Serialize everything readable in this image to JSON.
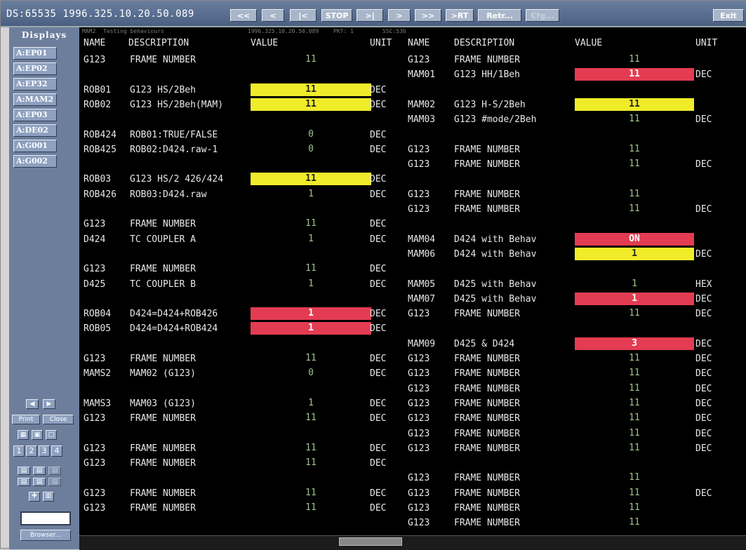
{
  "title": "DS:65535 1996.325.10.20.50.089",
  "nav": [
    "<<",
    "<",
    "|<",
    "STOP",
    ">|",
    ">",
    ">>",
    ">RT",
    "Retr...",
    "Cfg..."
  ],
  "exit_label": "Exit",
  "sidebar": {
    "title": "Displays",
    "items": [
      "A:EP01",
      "A:EP02",
      "A:EP32",
      "A:MAM2",
      "A:EP03",
      "A:DE02",
      "A:G001",
      "A:G002"
    ],
    "print_label": "Print",
    "close_label": "Close",
    "page_numbers": [
      "1",
      "2",
      "3",
      "4"
    ],
    "browser_label": "Browser..."
  },
  "header_strip": {
    "page": "MAM2",
    "subtitle": "Testing behaviours",
    "time": "1996.325.10.20.50.089",
    "pkt": "PKT: 1",
    "ssc": "SSC:536"
  },
  "columns": {
    "name": "NAME",
    "description": "DESCRIPTION",
    "value": "VALUE",
    "unit": "UNIT"
  },
  "left_rows": [
    {
      "r": 0,
      "name": "G123",
      "desc": "FRAME NUMBER",
      "value": "11",
      "hl": "",
      "unit": ""
    },
    {
      "r": 2,
      "name": "ROB01",
      "desc": "G123 HS/2Beh",
      "value": "11",
      "hl": "yellow",
      "unit": "DEC"
    },
    {
      "r": 3,
      "name": "ROB02",
      "desc": "G123 HS/2Beh(MAM)",
      "value": "11",
      "hl": "yellow",
      "unit": "DEC"
    },
    {
      "r": 5,
      "name": "ROB424",
      "desc": "ROB01:TRUE/FALSE",
      "value": "0",
      "hl": "",
      "unit": "DEC"
    },
    {
      "r": 6,
      "name": "ROB425",
      "desc": "ROB02:D424.raw-1",
      "value": "0",
      "hl": "",
      "unit": "DEC"
    },
    {
      "r": 8,
      "name": "ROB03",
      "desc": "G123 HS/2 426/424",
      "value": "11",
      "hl": "yellow",
      "unit": "DEC"
    },
    {
      "r": 9,
      "name": "ROB426",
      "desc": "ROB03:D424.raw",
      "value": "1",
      "hl": "",
      "unit": "DEC"
    },
    {
      "r": 11,
      "name": "G123",
      "desc": "FRAME NUMBER",
      "value": "11",
      "hl": "",
      "unit": "DEC"
    },
    {
      "r": 12,
      "name": "D424",
      "desc": "TC COUPLER A",
      "value": "1",
      "hl": "",
      "unit": "DEC"
    },
    {
      "r": 14,
      "name": "G123",
      "desc": "FRAME NUMBER",
      "value": "11",
      "hl": "",
      "unit": "DEC"
    },
    {
      "r": 15,
      "name": "D425",
      "desc": "TC COUPLER B",
      "value": "1",
      "hl": "",
      "unit": "DEC"
    },
    {
      "r": 17,
      "name": "ROB04",
      "desc": "D424=D424+ROB426",
      "value": "1",
      "hl": "red",
      "unit": "DEC"
    },
    {
      "r": 18,
      "name": "ROB05",
      "desc": "D424=D424+ROB424",
      "value": "1",
      "hl": "red",
      "unit": "DEC"
    },
    {
      "r": 20,
      "name": "G123",
      "desc": "FRAME NUMBER",
      "value": "11",
      "hl": "",
      "unit": "DEC"
    },
    {
      "r": 21,
      "name": "MAMS2",
      "desc": "MAM02 (G123)",
      "value": "0",
      "hl": "",
      "unit": "DEC"
    },
    {
      "r": 23,
      "name": "MAMS3",
      "desc": "MAM03 (G123)",
      "value": "1",
      "hl": "",
      "unit": "DEC"
    },
    {
      "r": 24,
      "name": "G123",
      "desc": "FRAME NUMBER",
      "value": "11",
      "hl": "",
      "unit": "DEC"
    },
    {
      "r": 26,
      "name": "G123",
      "desc": "FRAME NUMBER",
      "value": "11",
      "hl": "",
      "unit": "DEC"
    },
    {
      "r": 27,
      "name": "G123",
      "desc": "FRAME NUMBER",
      "value": "11",
      "hl": "",
      "unit": "DEC"
    },
    {
      "r": 29,
      "name": "G123",
      "desc": "FRAME NUMBER",
      "value": "11",
      "hl": "",
      "unit": "DEC"
    },
    {
      "r": 30,
      "name": "G123",
      "desc": "FRAME NUMBER",
      "value": "11",
      "hl": "",
      "unit": "DEC"
    }
  ],
  "right_rows": [
    {
      "r": 0,
      "name": "G123",
      "desc": "FRAME NUMBER",
      "value": "11",
      "hl": "",
      "unit": ""
    },
    {
      "r": 1,
      "name": "MAM01",
      "desc": "G123 HH/1Beh",
      "value": "11",
      "hl": "red",
      "unit": "DEC"
    },
    {
      "r": 3,
      "name": "MAM02",
      "desc": "G123 H-S/2Beh",
      "value": "11",
      "hl": "yellow",
      "unit": ""
    },
    {
      "r": 4,
      "name": "MAM03",
      "desc": "G123 #mode/2Beh",
      "value": "11",
      "hl": "",
      "unit": "DEC"
    },
    {
      "r": 6,
      "name": "G123",
      "desc": "FRAME NUMBER",
      "value": "11",
      "hl": "",
      "unit": ""
    },
    {
      "r": 7,
      "name": "G123",
      "desc": "FRAME NUMBER",
      "value": "11",
      "hl": "",
      "unit": "DEC"
    },
    {
      "r": 9,
      "name": "G123",
      "desc": "FRAME NUMBER",
      "value": "11",
      "hl": "",
      "unit": ""
    },
    {
      "r": 10,
      "name": "G123",
      "desc": "FRAME NUMBER",
      "value": "11",
      "hl": "",
      "unit": "DEC"
    },
    {
      "r": 12,
      "name": "MAM04",
      "desc": "D424 with Behav",
      "value": "ON",
      "hl": "red",
      "unit": ""
    },
    {
      "r": 13,
      "name": "MAM06",
      "desc": "D424 with Behav",
      "value": "1",
      "hl": "yellow",
      "unit": "DEC"
    },
    {
      "r": 15,
      "name": "MAM05",
      "desc": "D425 with Behav",
      "value": "1",
      "hl": "",
      "unit": "HEX"
    },
    {
      "r": 16,
      "name": "MAM07",
      "desc": "D425 with Behav",
      "value": "1",
      "hl": "red",
      "unit": "DEC"
    },
    {
      "r": 17,
      "name": "G123",
      "desc": "FRAME NUMBER",
      "value": "11",
      "hl": "",
      "unit": "DEC"
    },
    {
      "r": 19,
      "name": "MAM09",
      "desc": "D425 & D424",
      "value": "3",
      "hl": "red",
      "unit": "DEC"
    },
    {
      "r": 20,
      "name": "G123",
      "desc": "FRAME NUMBER",
      "value": "11",
      "hl": "",
      "unit": "DEC"
    },
    {
      "r": 21,
      "name": "G123",
      "desc": "FRAME NUMBER",
      "value": "11",
      "hl": "",
      "unit": "DEC"
    },
    {
      "r": 22,
      "name": "G123",
      "desc": "FRAME NUMBER",
      "value": "11",
      "hl": "",
      "unit": "DEC"
    },
    {
      "r": 23,
      "name": "G123",
      "desc": "FRAME NUMBER",
      "value": "11",
      "hl": "",
      "unit": "DEC"
    },
    {
      "r": 24,
      "name": "G123",
      "desc": "FRAME NUMBER",
      "value": "11",
      "hl": "",
      "unit": "DEC"
    },
    {
      "r": 25,
      "name": "G123",
      "desc": "FRAME NUMBER",
      "value": "11",
      "hl": "",
      "unit": "DEC"
    },
    {
      "r": 26,
      "name": "G123",
      "desc": "FRAME NUMBER",
      "value": "11",
      "hl": "",
      "unit": "DEC"
    },
    {
      "r": 28,
      "name": "G123",
      "desc": "FRAME NUMBER",
      "value": "11",
      "hl": "",
      "unit": ""
    },
    {
      "r": 29,
      "name": "G123",
      "desc": "FRAME NUMBER",
      "value": "11",
      "hl": "",
      "unit": "DEC"
    },
    {
      "r": 30,
      "name": "G123",
      "desc": "FRAME NUMBER",
      "value": "11",
      "hl": "",
      "unit": ""
    },
    {
      "r": 31,
      "name": "G123",
      "desc": "FRAME NUMBER",
      "value": "11",
      "hl": "",
      "unit": ""
    }
  ]
}
